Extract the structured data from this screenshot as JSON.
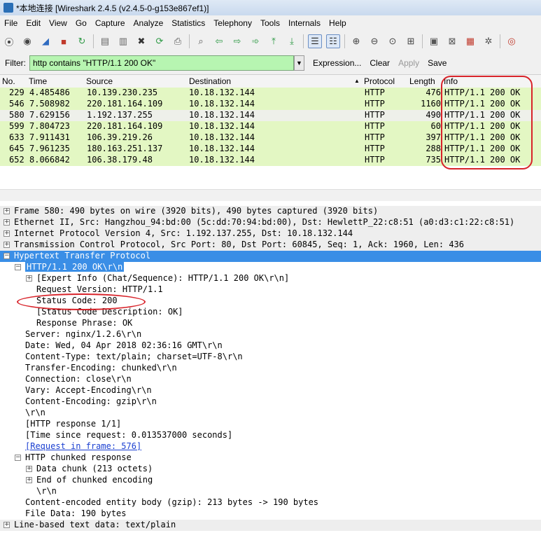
{
  "window": {
    "title": "*本地连接 [Wireshark 2.4.5 (v2.4.5-0-g153e867ef1)]"
  },
  "menu": [
    "File",
    "Edit",
    "View",
    "Go",
    "Capture",
    "Analyze",
    "Statistics",
    "Telephony",
    "Tools",
    "Internals",
    "Help"
  ],
  "toolbar_icons": [
    "interface-list-icon",
    "capture-options-icon",
    "start-capture-icon",
    "stop-capture-icon",
    "restart-capture-icon",
    "open-file-icon",
    "save-file-icon",
    "close-file-icon",
    "reload-icon",
    "print-icon",
    "find-icon",
    "go-back-icon",
    "go-forward-icon",
    "go-to-packet-icon",
    "first-packet-icon",
    "last-packet-icon",
    "colorize-icon",
    "autoscroll-icon",
    "zoom-in-icon",
    "zoom-out-icon",
    "normal-size-icon",
    "resize-columns-icon",
    "capture-filters-icon",
    "display-filters-icon",
    "coloring-rules-icon",
    "preferences-icon",
    "help-icon"
  ],
  "filter": {
    "label": "Filter:",
    "value": "http contains \"HTTP/1.1 200 OK\"",
    "expression": "Expression...",
    "clear": "Clear",
    "apply": "Apply",
    "save": "Save"
  },
  "columns": {
    "no": "No.",
    "time": "Time",
    "source": "Source",
    "destination": "Destination",
    "protocol": "Protocol",
    "length": "Length",
    "info": "Info"
  },
  "packets": [
    {
      "no": "229",
      "time": "4.485486",
      "source": "10.139.230.235",
      "destination": "10.18.132.144",
      "protocol": "HTTP",
      "length": "476",
      "info": "HTTP/1.1 200 OK"
    },
    {
      "no": "546",
      "time": "7.508982",
      "source": "220.181.164.109",
      "destination": "10.18.132.144",
      "protocol": "HTTP",
      "length": "1160",
      "info": "HTTP/1.1 200 OK"
    },
    {
      "no": "580",
      "time": "7.629156",
      "source": "1.192.137.255",
      "destination": "10.18.132.144",
      "protocol": "HTTP",
      "length": "490",
      "info": "HTTP/1.1 200 OK"
    },
    {
      "no": "599",
      "time": "7.804723",
      "source": "220.181.164.109",
      "destination": "10.18.132.144",
      "protocol": "HTTP",
      "length": "60",
      "info": "HTTP/1.1 200 OK"
    },
    {
      "no": "633",
      "time": "7.911431",
      "source": "106.39.219.26",
      "destination": "10.18.132.144",
      "protocol": "HTTP",
      "length": "397",
      "info": "HTTP/1.1 200 OK"
    },
    {
      "no": "645",
      "time": "7.961235",
      "source": "180.163.251.137",
      "destination": "10.18.132.144",
      "protocol": "HTTP",
      "length": "288",
      "info": "HTTP/1.1 200 OK"
    },
    {
      "no": "652",
      "time": "8.066842",
      "source": "106.38.179.48",
      "destination": "10.18.132.144",
      "protocol": "HTTP",
      "length": "735",
      "info": "HTTP/1.1 200 OK"
    }
  ],
  "details": [
    {
      "text": "Frame 580: 490 bytes on wire (3920 bits), 490 bytes captured (3920 bits)",
      "exp": "+"
    },
    {
      "text": "Ethernet II, Src: Hangzhou_94:bd:00 (5c:dd:70:94:bd:00), Dst: HewlettP_22:c8:51 (a0:d3:c1:22:c8:51)",
      "exp": "+"
    },
    {
      "text": "Internet Protocol Version 4, Src: 1.192.137.255, Dst: 10.18.132.144",
      "exp": "+"
    },
    {
      "text": "Transmission Control Protocol, Src Port: 80, Dst Port: 60845, Seq: 1, Ack: 1960, Len: 436",
      "exp": "+"
    },
    {
      "text": "Hypertext Transfer Protocol",
      "exp": "-"
    },
    {
      "text": "HTTP/1.1 200 OK\\r\\n",
      "exp": "-"
    },
    {
      "text": "[Expert Info (Chat/Sequence): HTTP/1.1 200 OK\\r\\n]",
      "exp": "+"
    },
    {
      "text": "Request Version: HTTP/1.1",
      "exp": ""
    },
    {
      "text": "Status Code: 200",
      "exp": ""
    },
    {
      "text": "[Status Code Description: OK]",
      "exp": ""
    },
    {
      "text": "Response Phrase: OK",
      "exp": ""
    },
    {
      "text": "Server: nginx/1.2.6\\r\\n",
      "exp": ""
    },
    {
      "text": "Date: Wed, 04 Apr 2018 02:36:16 GMT\\r\\n",
      "exp": ""
    },
    {
      "text": "Content-Type: text/plain; charset=UTF-8\\r\\n",
      "exp": ""
    },
    {
      "text": "Transfer-Encoding: chunked\\r\\n",
      "exp": ""
    },
    {
      "text": "Connection: close\\r\\n",
      "exp": ""
    },
    {
      "text": "Vary: Accept-Encoding\\r\\n",
      "exp": ""
    },
    {
      "text": "Content-Encoding: gzip\\r\\n",
      "exp": ""
    },
    {
      "text": "\\r\\n",
      "exp": ""
    },
    {
      "text": "[HTTP response 1/1]",
      "exp": ""
    },
    {
      "text": "[Time since request: 0.013537000 seconds]",
      "exp": ""
    },
    {
      "text": "[Request in frame: 576]",
      "exp": ""
    },
    {
      "text": "HTTP chunked response",
      "exp": "-"
    },
    {
      "text": "Data chunk (213 octets)",
      "exp": "+"
    },
    {
      "text": "End of chunked encoding",
      "exp": "+"
    },
    {
      "text": "\\r\\n",
      "exp": ""
    },
    {
      "text": "Content-encoded entity body (gzip): 213 bytes -> 190 bytes",
      "exp": ""
    },
    {
      "text": "File Data: 190 bytes",
      "exp": ""
    },
    {
      "text": "Line-based text data: text/plain",
      "exp": "+"
    }
  ],
  "colors": {
    "row_green": "#e3f7c3",
    "filter_valid": "#b7f5b1",
    "selection": "#3a8ee6",
    "annotation": "#d8232a"
  }
}
